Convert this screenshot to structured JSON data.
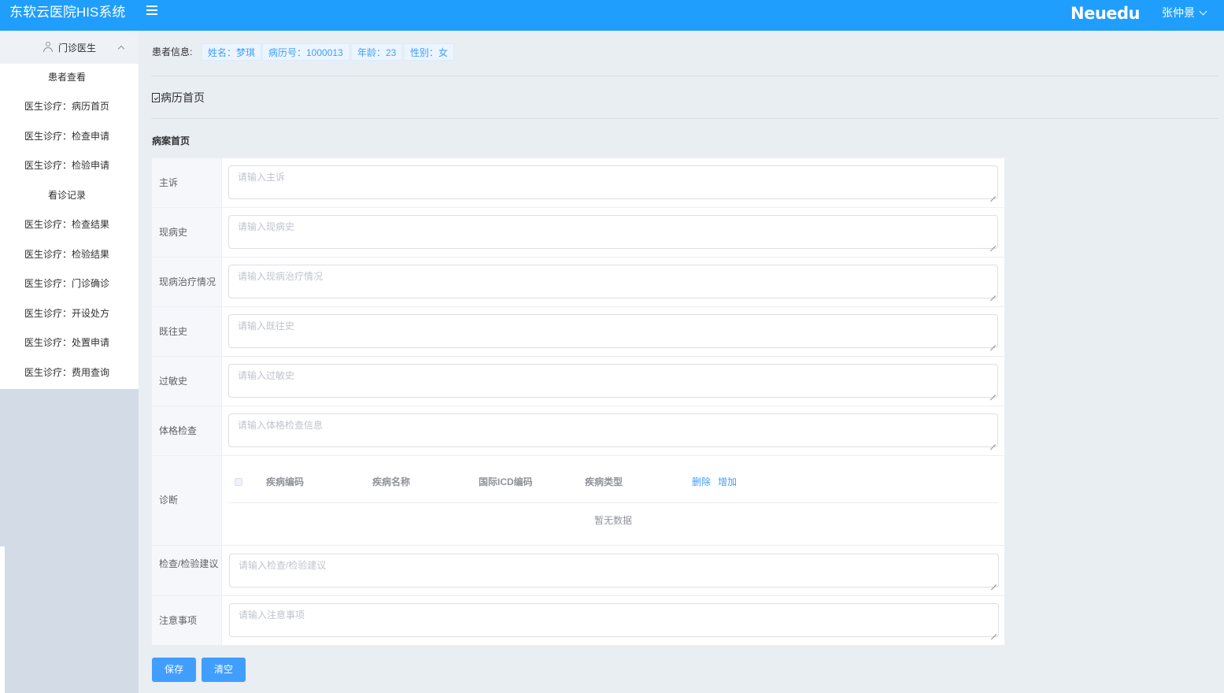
{
  "header": {
    "app_title": "东软云医院HIS系统",
    "brand": "Neuedu",
    "user_name": "张仲景"
  },
  "sidebar": {
    "group_label": "门诊医生",
    "items": [
      {
        "label": "患者查看"
      },
      {
        "label": "医生诊疗：病历首页"
      },
      {
        "label": "医生诊疗：检查申请"
      },
      {
        "label": "医生诊疗：检验申请"
      },
      {
        "label": "看诊记录"
      },
      {
        "label": "医生诊疗：检查结果"
      },
      {
        "label": "医生诊疗：检验结果"
      },
      {
        "label": "医生诊疗：门诊确诊"
      },
      {
        "label": "医生诊疗：开设处方"
      },
      {
        "label": "医生诊疗：处置申请"
      },
      {
        "label": "医生诊疗：费用查询"
      }
    ]
  },
  "patient": {
    "label": "患者信息:",
    "tags": [
      "姓名：梦琪",
      "病历号：1000013",
      "年龄：23",
      "性别：女"
    ]
  },
  "page": {
    "title": "病历首页",
    "section_title": "病案首页"
  },
  "form": {
    "rows": [
      {
        "label": "主诉",
        "placeholder": "请输入主诉"
      },
      {
        "label": "现病史",
        "placeholder": "请输入现病史"
      },
      {
        "label": "现病治疗情况",
        "placeholder": "请输入现病治疗情况"
      },
      {
        "label": "既往史",
        "placeholder": "请输入既往史"
      },
      {
        "label": "过敏史",
        "placeholder": "请输入过敏史"
      },
      {
        "label": "体格检查",
        "placeholder": "请输入体格检查信息"
      }
    ],
    "diagnosis": {
      "label": "诊断",
      "columns": [
        "疾病编码",
        "疾病名称",
        "国际ICD编码",
        "疾病类型"
      ],
      "delete_label": "删除",
      "add_label": "增加",
      "empty_text": "暂无数据"
    },
    "rows_after": [
      {
        "label": "检查/检验建议",
        "placeholder": "请输入检查/检验建议"
      },
      {
        "label": "注意事项",
        "placeholder": "请输入注意事项"
      }
    ]
  },
  "buttons": {
    "save": "保存",
    "clear": "清空"
  },
  "colors": {
    "header_bg": "#1f9efd",
    "primary": "#409eff",
    "sidebar_bg": "#d3dce6",
    "main_bg": "#e9eef3"
  }
}
